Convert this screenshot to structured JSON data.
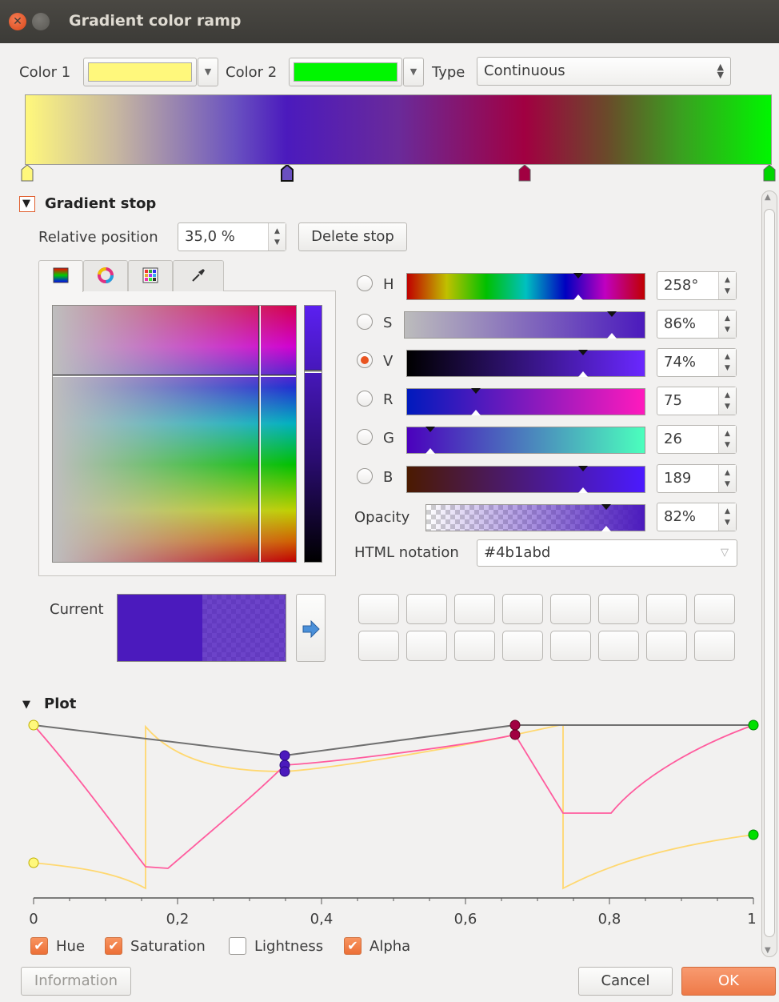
{
  "window": {
    "title": "Gradient color ramp"
  },
  "top": {
    "color1_label": "Color 1",
    "color1_value": "#fff87c",
    "color2_label": "Color 2",
    "color2_value": "#00f600",
    "type_label": "Type",
    "type_value": "Continuous"
  },
  "ramp": {
    "stops": [
      {
        "position": 0.0,
        "color": "#fff87c"
      },
      {
        "position": 0.35,
        "color": "#4b1abd"
      },
      {
        "position": 0.67,
        "color": "#a10041"
      },
      {
        "position": 1.0,
        "color": "#00f600"
      }
    ]
  },
  "gradient_stop": {
    "section_title": "Gradient stop",
    "relative_position_label": "Relative position",
    "relative_position_value": "35,0 %",
    "delete_stop_label": "Delete stop"
  },
  "color_picker": {
    "tabs": [
      "color-ramp-icon",
      "color-wheel-icon",
      "color-swatches-icon",
      "eyedropper-icon"
    ],
    "channels": [
      {
        "key": "H",
        "value": "258°",
        "selected": false,
        "level": 0.72
      },
      {
        "key": "S",
        "value": "86%",
        "selected": false,
        "level": 0.86
      },
      {
        "key": "V",
        "value": "74%",
        "selected": true,
        "level": 0.74
      },
      {
        "key": "R",
        "value": "75",
        "selected": false,
        "level": 0.29
      },
      {
        "key": "G",
        "value": "26",
        "selected": false,
        "level": 0.1
      },
      {
        "key": "B",
        "value": "189",
        "selected": false,
        "level": 0.74
      }
    ],
    "opacity_label": "Opacity",
    "opacity_value": "82%",
    "opacity_level": 0.82,
    "html_notation_label": "HTML notation",
    "html_notation_value": "#4b1abd",
    "current_label": "Current",
    "current_color": "#4b1abd"
  },
  "plot": {
    "section_title": "Plot",
    "x_ticks": [
      "0",
      "0,2",
      "0,4",
      "0,6",
      "0,8",
      "1"
    ],
    "checkboxes": [
      {
        "label": "Hue",
        "checked": true
      },
      {
        "label": "Saturation",
        "checked": true
      },
      {
        "label": "Lightness",
        "checked": false
      },
      {
        "label": "Alpha",
        "checked": true
      }
    ]
  },
  "footer": {
    "information_label": "Information",
    "cancel_label": "Cancel",
    "ok_label": "OK"
  }
}
